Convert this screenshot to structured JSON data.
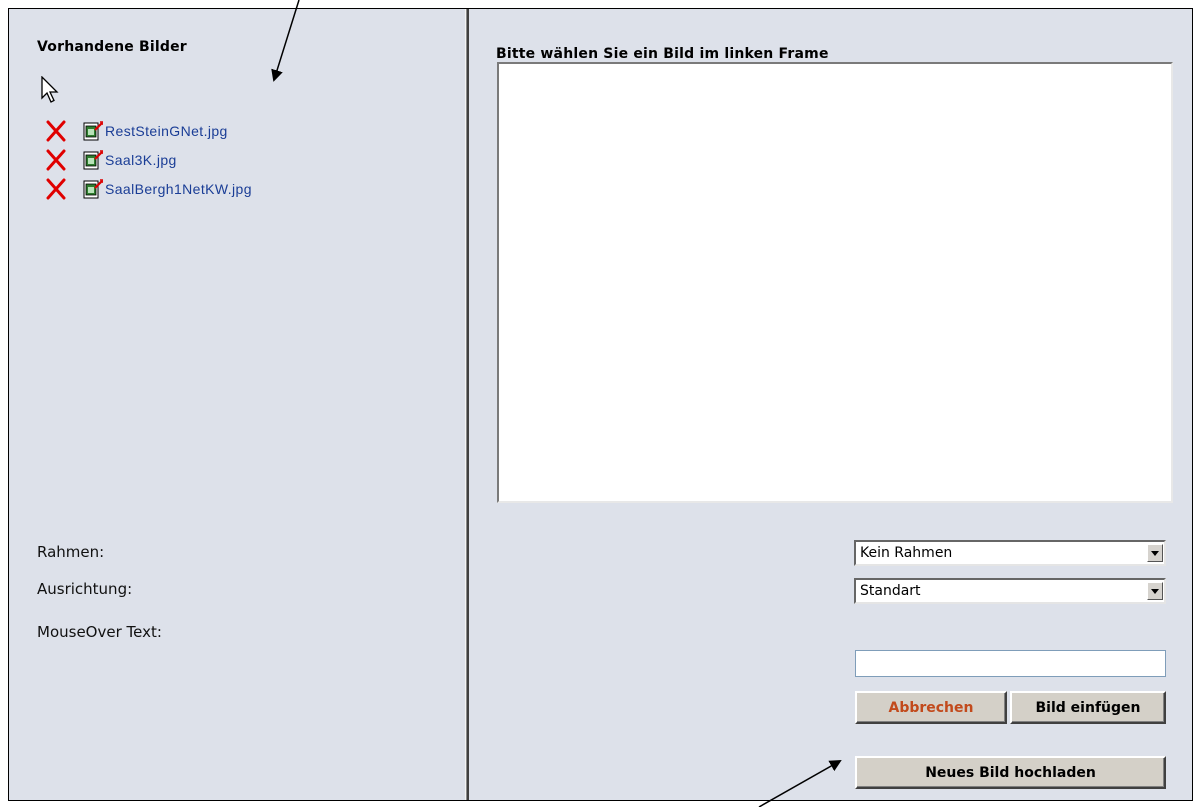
{
  "left_frame": {
    "title": "Vorhandene Bilder",
    "files": [
      {
        "name": "RestSteinGNet.jpg"
      },
      {
        "name": "Saal3K.jpg"
      },
      {
        "name": "SaalBergh1NetKW.jpg"
      }
    ]
  },
  "right_frame": {
    "title": "Bitte wählen Sie ein Bild im linken Frame",
    "form": {
      "border_label": "Rahmen:",
      "border_value": "Kein Rahmen",
      "align_label": "Ausrichtung:",
      "align_value": "Standart",
      "mouseover_label": "MouseOver Text:",
      "mouseover_value": ""
    },
    "buttons": {
      "cancel": "Abbrechen",
      "insert": "Bild einfügen",
      "upload": "Neues Bild hochladen"
    }
  },
  "colors": {
    "panel_bg": "#dde1ea",
    "link": "#1a3d96",
    "cancel_text": "#c24a1c",
    "delete_icon": "#e00000"
  },
  "icons": [
    "cursor-arrow-icon",
    "delete-icon",
    "edit-image-icon",
    "dropdown-arrow-icon"
  ]
}
